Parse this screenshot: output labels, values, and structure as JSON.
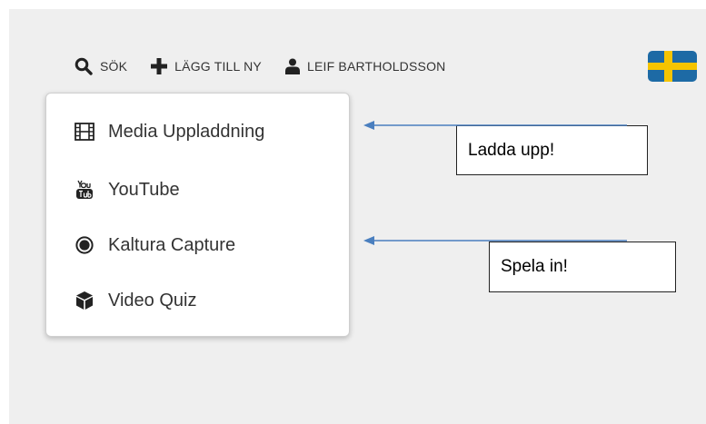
{
  "topnav": {
    "search_label": "SÖK",
    "add_label": "LÄGG TILL NY",
    "user_label": "LEIF BARTHOLDSSON"
  },
  "dropdown": {
    "items": [
      {
        "label": "Media Uppladdning",
        "icon": "film-icon"
      },
      {
        "label": "YouTube",
        "icon": "youtube-icon"
      },
      {
        "label": "Kaltura Capture",
        "icon": "record-icon"
      },
      {
        "label": "Video Quiz",
        "icon": "cube-icon"
      }
    ]
  },
  "annotations": {
    "upload": "Ladda upp!",
    "record": "Spela in!"
  },
  "colors": {
    "background": "#efefef",
    "arrow": "#4a7fbf",
    "flag_blue": "#1d6aa5",
    "flag_yellow": "#f5c400"
  }
}
